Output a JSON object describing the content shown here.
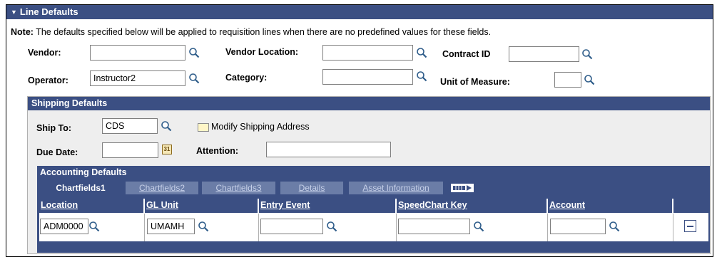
{
  "section": {
    "title": "Line Defaults"
  },
  "note": {
    "prefix": "Note:",
    "text": "The defaults specified below will be applied to requisition lines when there are no predefined values for these fields."
  },
  "fields": {
    "vendor": {
      "label": "Vendor:",
      "value": ""
    },
    "vendor_location": {
      "label": "Vendor Location:",
      "value": ""
    },
    "contract_id": {
      "label": "Contract ID",
      "value": ""
    },
    "operator": {
      "label": "Operator:",
      "value": "Instructor2"
    },
    "category": {
      "label": "Category:",
      "value": ""
    },
    "unit_of_measure": {
      "label": "Unit of Measure:",
      "value": ""
    }
  },
  "shipping": {
    "title": "Shipping Defaults",
    "ship_to": {
      "label": "Ship To:",
      "value": "CDS"
    },
    "modify_link": "Modify Shipping Address",
    "due_date": {
      "label": "Due Date:",
      "value": "",
      "calendar_text": "31"
    },
    "attention": {
      "label": "Attention:",
      "value": ""
    }
  },
  "accounting": {
    "title": "Accounting Defaults",
    "tabs": [
      "Chartfields1",
      "Chartfields2",
      "Chartfields3",
      "Details",
      "Asset Information"
    ],
    "columns": [
      "Location",
      "GL Unit",
      "Entry Event",
      "SpeedChart Key",
      "Account"
    ],
    "row": {
      "location": "ADM0000",
      "gl_unit": "UMAMH",
      "entry_event": "",
      "speedchart_key": "",
      "account": ""
    }
  },
  "colors": {
    "header": "#3b4f83",
    "panel": "#eeeeee"
  }
}
